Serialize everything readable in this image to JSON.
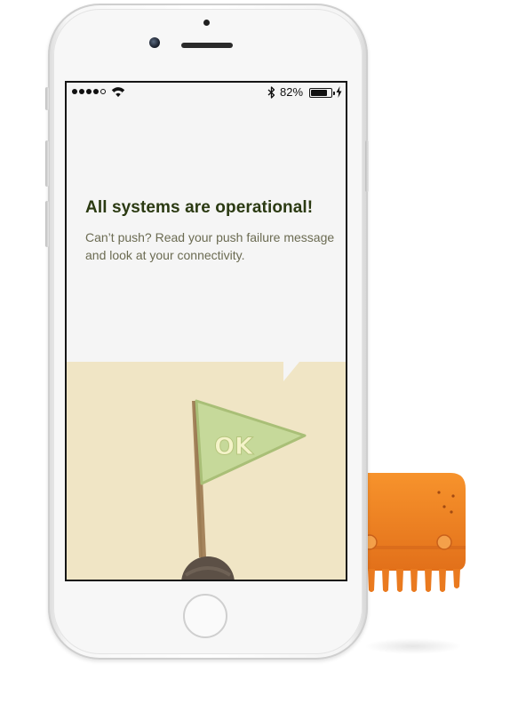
{
  "status_bar": {
    "signal_bars_filled": 4,
    "signal_bars_total": 5,
    "wifi_icon": "wifi-icon",
    "bluetooth_icon": "bluetooth-icon",
    "battery_percent": "82%",
    "battery_level": 0.82,
    "charging_icon": "lightning-bolt-icon"
  },
  "status_message": {
    "title": "All systems are operational!",
    "body": "Can’t push? Read your push failure message and look at your connectivity."
  },
  "illustration": {
    "flag_text": "OK",
    "flag_icon": "ok-flag-icon",
    "mascot_icon": "orange-octopus-mascot-icon"
  },
  "colors": {
    "title": "#2b3a12",
    "body": "#6b6b52",
    "screen_bg": "#f5f5f5",
    "ground_bg": "#f0e5c5",
    "flag": "#c6d99a",
    "flag_text": "#f4f3c8",
    "pole": "#a5845c",
    "mascot": "#f2801f"
  }
}
